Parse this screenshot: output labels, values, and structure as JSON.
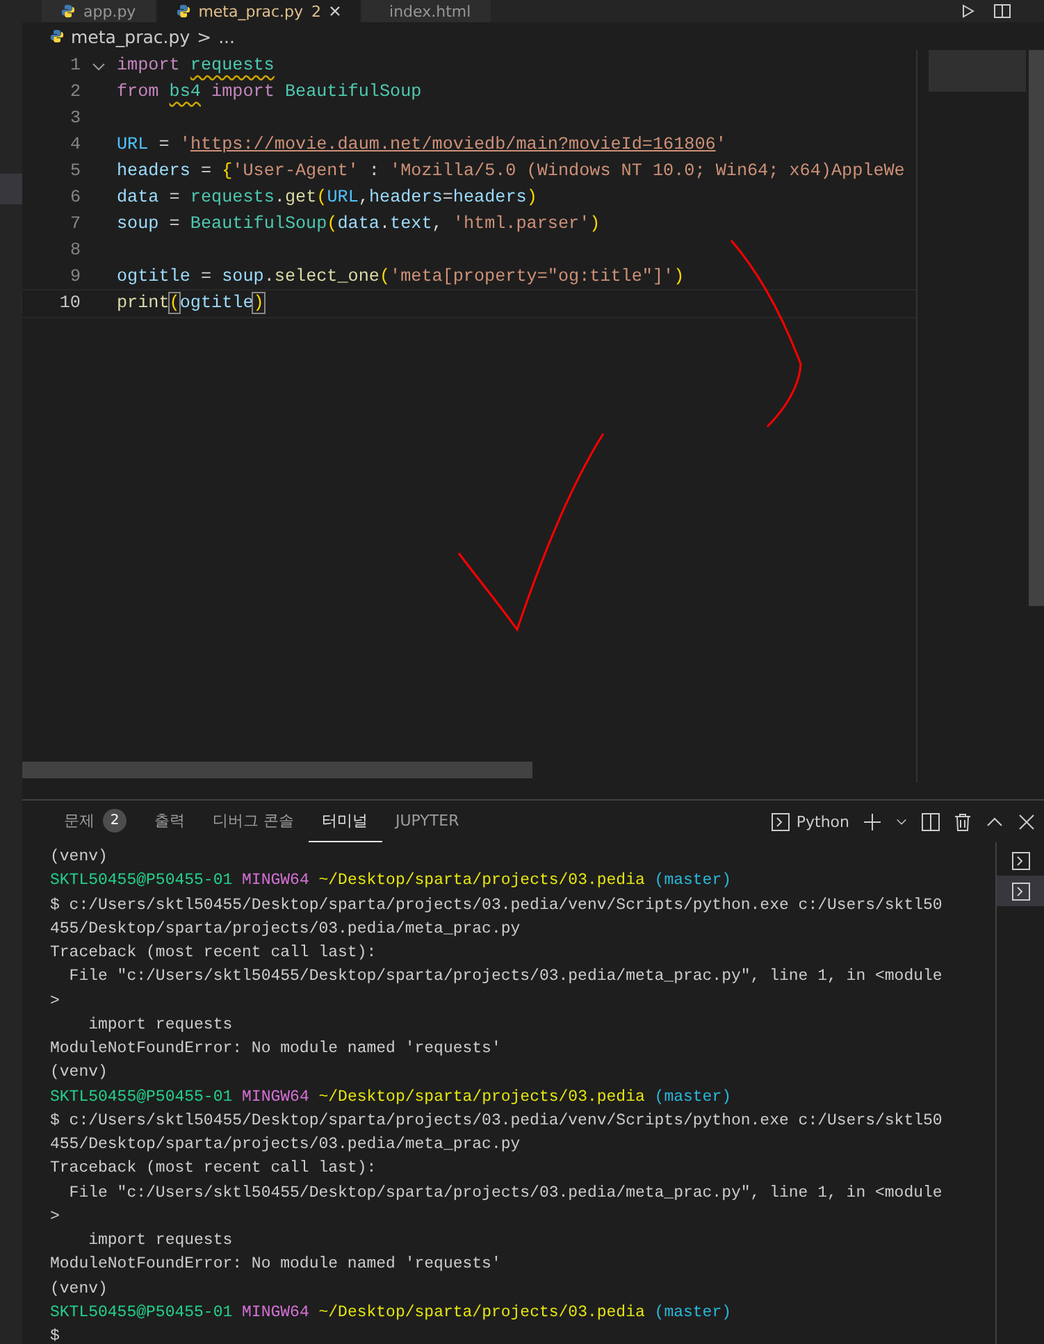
{
  "editor_tabs": [
    {
      "label": "app.py",
      "selected": false
    },
    {
      "label": "meta_prac.py",
      "selected": true,
      "problems": "2"
    },
    {
      "label": "index.html",
      "selected": false
    }
  ],
  "breadcrumb": {
    "file": "meta_prac.py",
    "separator": ">",
    "rest": "..."
  },
  "code_lines": [
    {
      "number": "1",
      "current": false,
      "tokens": [
        {
          "kind": "keyword",
          "text": "import "
        },
        {
          "kind": "module",
          "text": "requests"
        }
      ]
    },
    {
      "number": "2",
      "current": false,
      "tokens": [
        {
          "kind": "keyword",
          "text": "from "
        },
        {
          "kind": "module",
          "text": "bs4"
        },
        {
          "kind": "keyword",
          "text": " import "
        },
        {
          "kind": "class",
          "text": "BeautifulSoup"
        }
      ]
    },
    {
      "number": "3",
      "current": false
    },
    {
      "number": "4",
      "current": false,
      "tokens": [
        {
          "kind": "const",
          "text": "URL"
        },
        {
          "kind": "plain",
          "text": " = "
        },
        {
          "kind": "string",
          "text": "'"
        },
        {
          "kind": "url",
          "text": "https://movie.daum.net/moviedb/main?movieId=161806"
        },
        {
          "kind": "string",
          "text": "'"
        }
      ]
    },
    {
      "number": "5",
      "current": false,
      "tokens": [
        {
          "kind": "var",
          "text": "headers"
        },
        {
          "kind": "plain",
          "text": " = "
        },
        {
          "kind": "brace",
          "text": "{"
        },
        {
          "kind": "string",
          "text": "'User-Agent'"
        },
        {
          "kind": "plain",
          "text": " : "
        },
        {
          "kind": "string",
          "text": "'Mozilla/5.0 (Windows NT 10.0; Win64; x64)AppleWe"
        }
      ]
    },
    {
      "number": "6",
      "current": false,
      "tokens": [
        {
          "kind": "var",
          "text": "data"
        },
        {
          "kind": "plain",
          "text": " = "
        },
        {
          "kind": "class",
          "text": "requests"
        },
        {
          "kind": "plain",
          "text": "."
        },
        {
          "kind": "func",
          "text": "get"
        },
        {
          "kind": "brace",
          "text": "("
        },
        {
          "kind": "const",
          "text": "URL"
        },
        {
          "kind": "plain",
          "text": ","
        },
        {
          "kind": "var",
          "text": "headers"
        },
        {
          "kind": "plain",
          "text": "="
        },
        {
          "kind": "var",
          "text": "headers"
        },
        {
          "kind": "brace",
          "text": ")"
        }
      ]
    },
    {
      "number": "7",
      "current": false,
      "tokens": [
        {
          "kind": "var",
          "text": "soup"
        },
        {
          "kind": "plain",
          "text": " = "
        },
        {
          "kind": "class",
          "text": "BeautifulSoup"
        },
        {
          "kind": "brace",
          "text": "("
        },
        {
          "kind": "var",
          "text": "data"
        },
        {
          "kind": "plain",
          "text": "."
        },
        {
          "kind": "var",
          "text": "text"
        },
        {
          "kind": "plain",
          "text": ", "
        },
        {
          "kind": "string",
          "text": "'html.parser'"
        },
        {
          "kind": "brace",
          "text": ")"
        }
      ]
    },
    {
      "number": "8",
      "current": false
    },
    {
      "number": "9",
      "current": false,
      "tokens": [
        {
          "kind": "var",
          "text": "ogtitle"
        },
        {
          "kind": "plain",
          "text": " = "
        },
        {
          "kind": "var",
          "text": "soup"
        },
        {
          "kind": "plain",
          "text": "."
        },
        {
          "kind": "func",
          "text": "select_one"
        },
        {
          "kind": "brace",
          "text": "("
        },
        {
          "kind": "string",
          "text": "'meta[property=\"og:title\"]'"
        },
        {
          "kind": "brace",
          "text": ")"
        }
      ]
    },
    {
      "number": "10",
      "current": true,
      "tokens": [
        {
          "kind": "func",
          "text": "print"
        },
        {
          "kind": "match",
          "text": "("
        },
        {
          "kind": "var",
          "text": "ogtitle"
        },
        {
          "kind": "match",
          "text": ")"
        }
      ]
    }
  ],
  "panel_tabs": [
    {
      "label": "문제",
      "badge": "2",
      "selected": false
    },
    {
      "label": "출력",
      "selected": false
    },
    {
      "label": "디버그 콘솔",
      "selected": false
    },
    {
      "label": "터미널",
      "selected": true
    },
    {
      "label": "JUPYTER",
      "selected": false
    }
  ],
  "terminal_profile": "Python",
  "terminal_list": [
    {
      "selected": false
    },
    {
      "selected": true
    }
  ],
  "terminal_lines": [
    [
      {
        "kind": "plain",
        "text": "(venv)"
      }
    ],
    [
      {
        "kind": "user",
        "text": "SKTL50455@P50455-01 "
      },
      {
        "kind": "host",
        "text": "MINGW64 "
      },
      {
        "kind": "path",
        "text": "~/Desktop/sparta/projects/03.pedia "
      },
      {
        "kind": "branch",
        "text": "(master)"
      }
    ],
    [
      {
        "kind": "plain",
        "text": "$ c:/Users/sktl50455/Desktop/sparta/projects/03.pedia/venv/Scripts/python.exe c:/Users/sktl50"
      }
    ],
    [
      {
        "kind": "plain",
        "text": "455/Desktop/sparta/projects/03.pedia/meta_prac.py"
      }
    ],
    [
      {
        "kind": "plain",
        "text": "Traceback (most recent call last):"
      }
    ],
    [
      {
        "kind": "plain",
        "text": "  File \"c:/Users/sktl50455/Desktop/sparta/projects/03.pedia/meta_prac.py\", line 1, in <module"
      }
    ],
    [
      {
        "kind": "plain",
        "text": ">"
      }
    ],
    [
      {
        "kind": "plain",
        "text": "    import requests"
      }
    ],
    [
      {
        "kind": "plain",
        "text": "ModuleNotFoundError: No module named 'requests'"
      }
    ],
    [
      {
        "kind": "plain",
        "text": "(venv)"
      }
    ],
    [
      {
        "kind": "user",
        "text": "SKTL50455@P50455-01 "
      },
      {
        "kind": "host",
        "text": "MINGW64 "
      },
      {
        "kind": "path",
        "text": "~/Desktop/sparta/projects/03.pedia "
      },
      {
        "kind": "branch",
        "text": "(master)"
      }
    ],
    [
      {
        "kind": "plain",
        "text": "$ c:/Users/sktl50455/Desktop/sparta/projects/03.pedia/venv/Scripts/python.exe c:/Users/sktl50"
      }
    ],
    [
      {
        "kind": "plain",
        "text": "455/Desktop/sparta/projects/03.pedia/meta_prac.py"
      }
    ],
    [
      {
        "kind": "plain",
        "text": "Traceback (most recent call last):"
      }
    ],
    [
      {
        "kind": "plain",
        "text": "  File \"c:/Users/sktl50455/Desktop/sparta/projects/03.pedia/meta_prac.py\", line 1, in <module"
      }
    ],
    [
      {
        "kind": "plain",
        "text": ">"
      }
    ],
    [
      {
        "kind": "plain",
        "text": "    import requests"
      }
    ],
    [
      {
        "kind": "plain",
        "text": "ModuleNotFoundError: No module named 'requests'"
      }
    ],
    [
      {
        "kind": "plain",
        "text": "(venv)"
      }
    ],
    [
      {
        "kind": "user",
        "text": "SKTL50455@P50455-01 "
      },
      {
        "kind": "host",
        "text": "MINGW64 "
      },
      {
        "kind": "path",
        "text": "~/Desktop/sparta/projects/03.pedia "
      },
      {
        "kind": "branch",
        "text": "(master)"
      }
    ],
    [
      {
        "kind": "plain",
        "text": "$"
      }
    ]
  ]
}
